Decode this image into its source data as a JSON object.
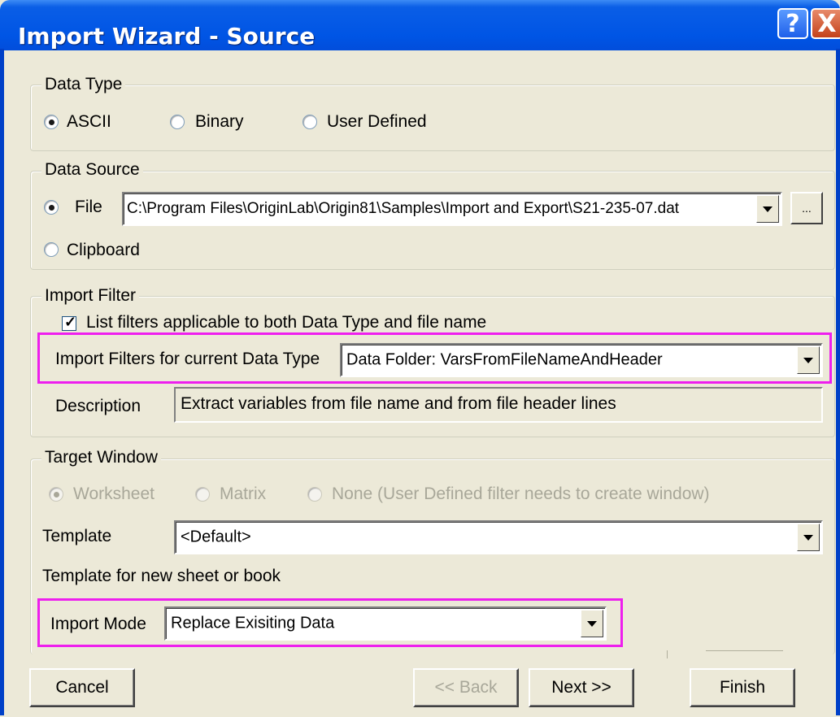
{
  "window": {
    "title": "Import Wizard - Source",
    "help": "?",
    "close": "X"
  },
  "data_type": {
    "legend": "Data Type",
    "options": [
      {
        "label": "ASCII",
        "selected": true
      },
      {
        "label": "Binary",
        "selected": false
      },
      {
        "label": "User Defined",
        "selected": false
      }
    ]
  },
  "data_source": {
    "legend": "Data Source",
    "file_label": "File",
    "file_path": "C:\\Program Files\\OriginLab\\Origin81\\Samples\\Import and Export\\S21-235-07.dat",
    "browse": "...",
    "clipboard_label": "Clipboard"
  },
  "import_filter": {
    "legend": "Import Filter",
    "checkbox_label": "List filters applicable to both Data Type and file name",
    "filters_label": "Import Filters for current Data Type",
    "filters_value": "Data Folder: VarsFromFileNameAndHeader",
    "description_label": "Description",
    "description_value": "Extract variables from file name and from file header lines"
  },
  "target_window": {
    "legend": "Target Window",
    "options": [
      {
        "label": "Worksheet",
        "selected": true
      },
      {
        "label": "Matrix",
        "selected": false
      },
      {
        "label": "None (User Defined filter needs to create window)",
        "selected": false
      }
    ],
    "template_label": "Template",
    "template_value": "<Default>",
    "template_note": "Template for new sheet or book",
    "import_mode_label": "Import Mode",
    "import_mode_value": "Replace Exisiting Data"
  },
  "buttons": {
    "cancel": "Cancel",
    "back": "<< Back",
    "next": "Next >>",
    "finish": "Finish"
  },
  "colors": {
    "title_bar": "#0055e5",
    "highlight": "#ee1fee",
    "dialog_bg": "#ece9d8"
  }
}
